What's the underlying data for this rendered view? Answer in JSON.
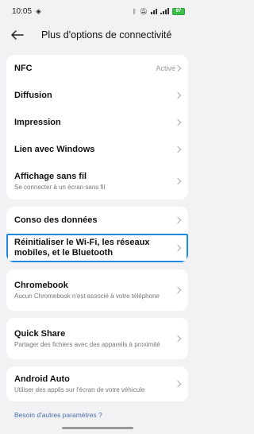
{
  "status_bar": {
    "time": "10:05",
    "battery": "97"
  },
  "header": {
    "title": "Plus d'options de connectivité"
  },
  "cards": [
    {
      "rows": [
        {
          "title": "NFC",
          "value": "Activé"
        },
        {
          "title": "Diffusion"
        },
        {
          "title": "Impression"
        },
        {
          "title": "Lien avec Windows"
        },
        {
          "title": "Affichage sans fil",
          "subtitle": "Se connecter à un écran sans fil"
        }
      ]
    },
    {
      "rows": [
        {
          "title": "Conso des données"
        },
        {
          "title": "Réinitialiser le Wi-Fi, les réseaux mobiles, et le Bluetooth"
        }
      ]
    },
    {
      "rows": [
        {
          "title": "Chromebook",
          "subtitle": "Aucun Chromebook n'est associé à votre téléphone"
        }
      ]
    },
    {
      "rows": [
        {
          "title": "Quick Share",
          "subtitle": "Partager des fichiers avec des appareils à proximité"
        }
      ]
    },
    {
      "rows": [
        {
          "title": "Android Auto",
          "subtitle": "Utiliser des applis sur l'écran de votre véhicule"
        }
      ]
    }
  ],
  "footer": {
    "link": "Besoin d'autres paramètres ?"
  },
  "colors": {
    "highlight": "#1e88e5",
    "battery": "#3ec14b"
  }
}
